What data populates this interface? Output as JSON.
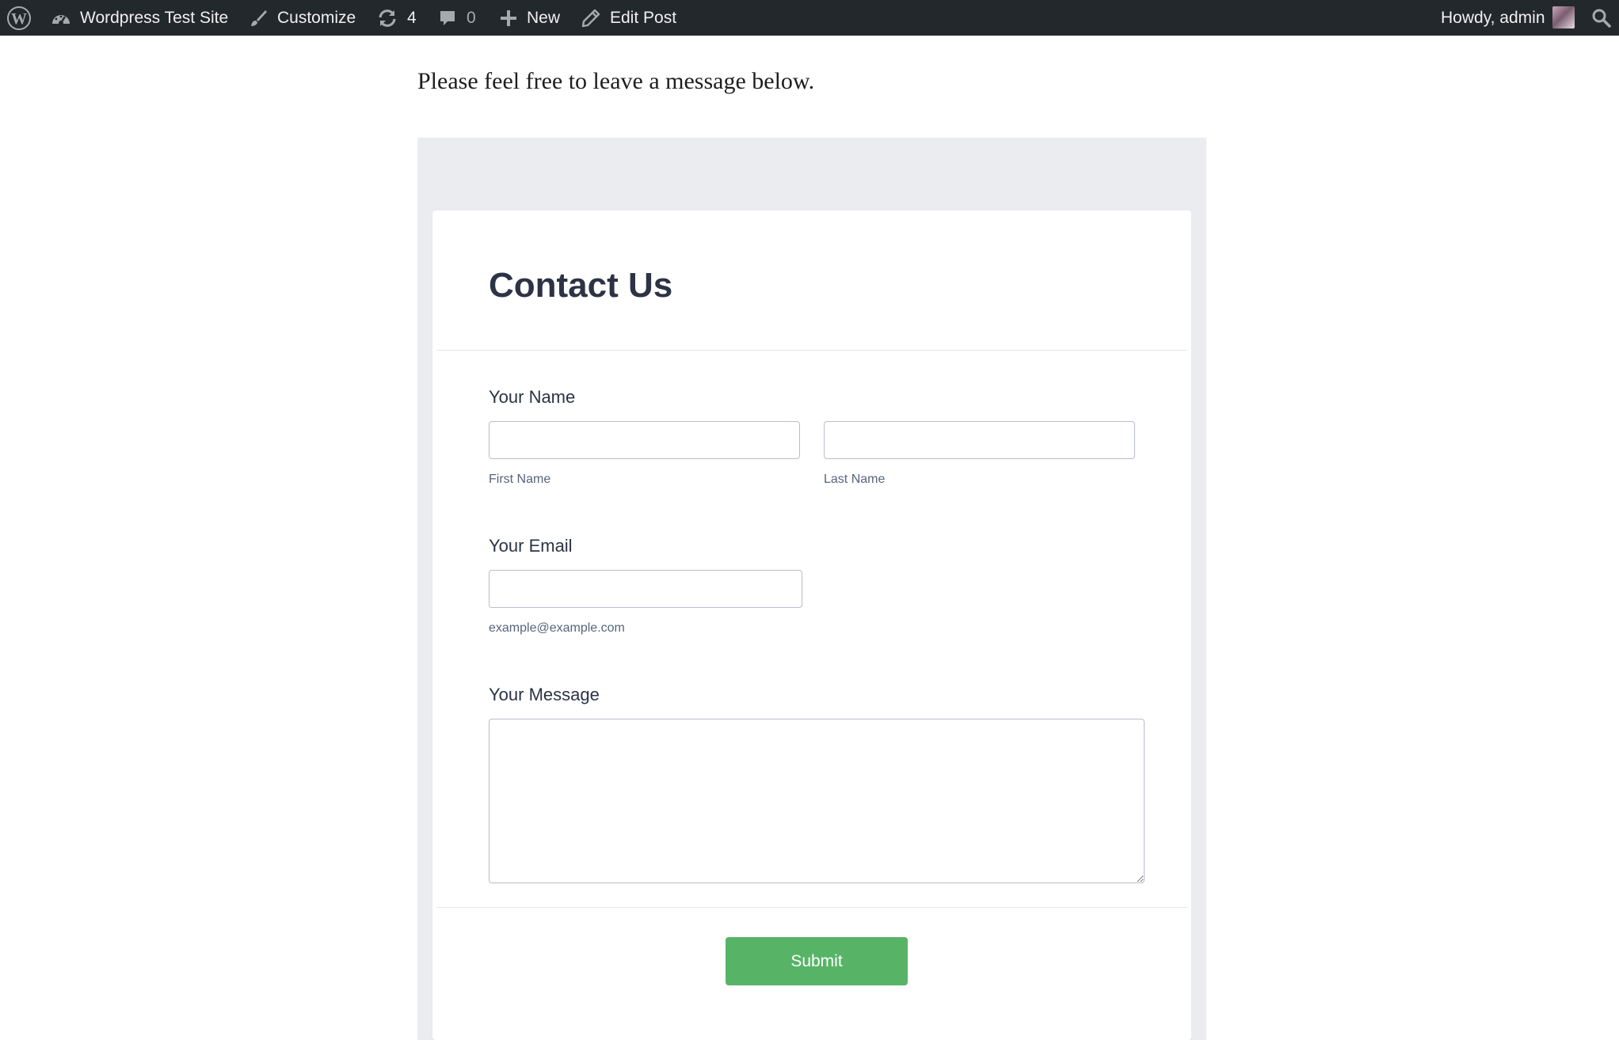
{
  "admin_bar": {
    "site_name": "Wordpress Test Site",
    "customize_label": "Customize",
    "updates_count": "4",
    "comments_count": "0",
    "new_label": "New",
    "edit_post_label": "Edit Post",
    "greeting": "Howdy, admin",
    "icons": [
      "wordpress-logo-icon",
      "dashboard-icon",
      "brush-icon",
      "refresh-icon",
      "comment-icon",
      "plus-icon",
      "pencil-icon",
      "search-icon"
    ]
  },
  "page": {
    "intro_text": "Please feel free to leave a message below."
  },
  "form": {
    "title": "Contact Us",
    "name": {
      "label": "Your Name",
      "first_value": "",
      "last_value": "",
      "first_sublabel": "First Name",
      "last_sublabel": "Last Name"
    },
    "email": {
      "label": "Your Email",
      "value": "",
      "sublabel": "example@example.com"
    },
    "message": {
      "label": "Your Message",
      "value": ""
    },
    "submit_label": "Submit"
  },
  "colors": {
    "admin_bar_bg": "#23282d",
    "form_background": "#ebecf0",
    "title_color": "#2c3345",
    "submit_button": "#57b467"
  }
}
